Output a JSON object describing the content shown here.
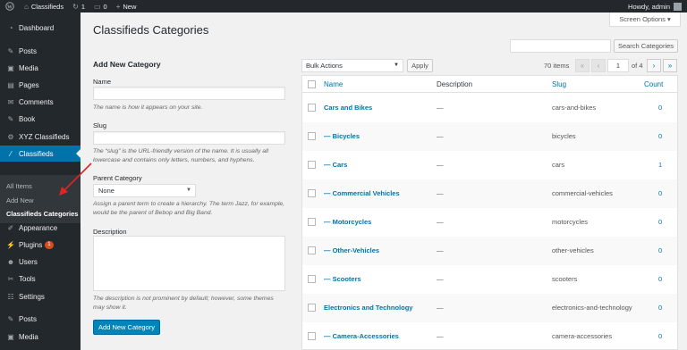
{
  "adminbar": {
    "site_name": "Classifieds",
    "updates_count": "1",
    "comments_count": "0",
    "new_label": "New",
    "howdy": "Howdy, admin"
  },
  "sidebar": {
    "items": [
      {
        "label": "Dashboard",
        "icon": "dashboard-icon",
        "glyph": "◔"
      },
      {
        "label": "Posts",
        "icon": "pushpin-icon",
        "glyph": "✎"
      },
      {
        "label": "Media",
        "icon": "media-icon",
        "glyph": "▣"
      },
      {
        "label": "Pages",
        "icon": "page-icon",
        "glyph": "▤"
      },
      {
        "label": "Comments",
        "icon": "comment-icon",
        "glyph": "✉"
      },
      {
        "label": "Book",
        "icon": "pushpin-icon",
        "glyph": "✎"
      },
      {
        "label": "XYZ Classifieds",
        "icon": "gear-icon",
        "glyph": "⚙"
      },
      {
        "label": "Classifieds",
        "icon": "slash-icon",
        "glyph": "⁄"
      },
      {
        "label": "Appearance",
        "icon": "brush-icon",
        "glyph": "✐"
      },
      {
        "label": "Plugins",
        "icon": "plug-icon",
        "glyph": "⚡",
        "badge": "1"
      },
      {
        "label": "Users",
        "icon": "user-icon",
        "glyph": "☻"
      },
      {
        "label": "Tools",
        "icon": "wrench-icon",
        "glyph": "✂"
      },
      {
        "label": "Settings",
        "icon": "settings-icon",
        "glyph": "☷"
      },
      {
        "label": "Posts",
        "icon": "pushpin-icon",
        "glyph": "✎"
      },
      {
        "label": "Media",
        "icon": "media-icon",
        "glyph": "▣"
      }
    ],
    "submenu": [
      "All Items",
      "Add New",
      "Classifieds Categories"
    ]
  },
  "screen_options": "Screen Options ▾",
  "page_title": "Classifieds Categories",
  "search_button": "Search Categories",
  "form": {
    "heading": "Add New Category",
    "name_label": "Name",
    "name_help": "The name is how it appears on your site.",
    "slug_label": "Slug",
    "slug_help": "The “slug” is the URL-friendly version of the name. It is usually all lowercase and contains only letters, numbers, and hyphens.",
    "parent_label": "Parent Category",
    "parent_value": "None",
    "parent_help": "Assign a parent term to create a hierarchy. The term Jazz, for example, would be the parent of Bebop and Big Band.",
    "description_label": "Description",
    "description_help": "The description is not prominent by default; however, some themes may show it.",
    "submit_label": "Add New Category"
  },
  "table_controls": {
    "bulk_actions": "Bulk Actions",
    "apply": "Apply",
    "items_count": "70 items",
    "first": "«",
    "prev": "‹",
    "current_page": "1",
    "of_pages": "of 4",
    "next": "›",
    "last": "»"
  },
  "table": {
    "columns": [
      "Name",
      "Description",
      "Slug",
      "Count"
    ],
    "rows": [
      {
        "name": "Cars and Bikes",
        "description": "—",
        "slug": "cars-and-bikes",
        "count": "0"
      },
      {
        "name": "— Bicycles",
        "description": "—",
        "slug": "bicycles",
        "count": "0"
      },
      {
        "name": "— Cars",
        "description": "—",
        "slug": "cars",
        "count": "1"
      },
      {
        "name": "— Commercial Vehicles",
        "description": "—",
        "slug": "commercial-vehicles",
        "count": "0"
      },
      {
        "name": "— Motorcycles",
        "description": "—",
        "slug": "motorcycles",
        "count": "0"
      },
      {
        "name": "— Other-Vehicles",
        "description": "—",
        "slug": "other-vehicles",
        "count": "0"
      },
      {
        "name": "— Scooters",
        "description": "—",
        "slug": "scooters",
        "count": "0"
      },
      {
        "name": "Electronics and Technology",
        "description": "—",
        "slug": "electronics-and-technology",
        "count": "0"
      },
      {
        "name": "— Camera-Accessories",
        "description": "—",
        "slug": "camera-accessories",
        "count": "0"
      }
    ]
  },
  "colors": {
    "accent": "#0073aa",
    "admin_dark": "#23282d",
    "annotation": "#e02424"
  }
}
